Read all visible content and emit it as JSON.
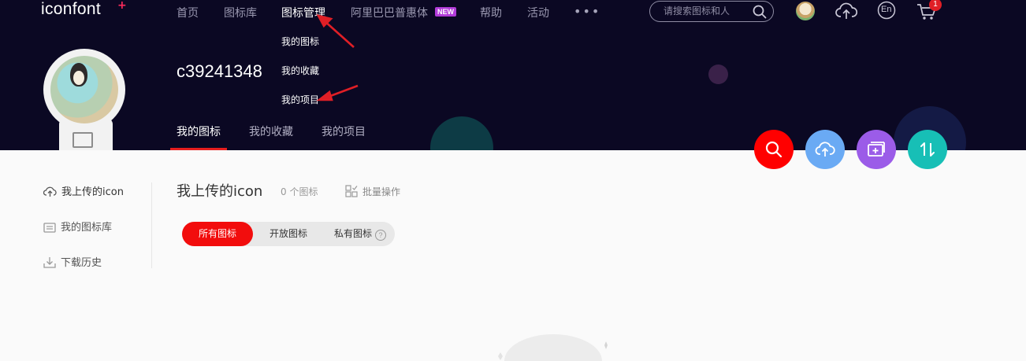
{
  "brand": {
    "logo_text": "iconfont",
    "logo_plus": "+"
  },
  "nav": {
    "items": [
      {
        "label": "首页"
      },
      {
        "label": "图标库"
      },
      {
        "label": "图标管理"
      },
      {
        "label": "阿里巴巴普惠体"
      },
      {
        "label": "帮助"
      },
      {
        "label": "活动"
      }
    ],
    "new_badge": "NEW",
    "more": "•••"
  },
  "search": {
    "placeholder": "请搜索图标和人"
  },
  "header_actions": {
    "lang_label": "En",
    "cart_count": "1"
  },
  "dropdown": {
    "items": [
      "我的图标",
      "我的收藏",
      "我的项目"
    ]
  },
  "profile": {
    "username": "c39241348"
  },
  "sub_tabs": [
    "我的图标",
    "我的收藏",
    "我的项目"
  ],
  "sidebar": {
    "items": [
      "我上传的icon",
      "我的图标库",
      "下载历史"
    ]
  },
  "main": {
    "title": "我上传的icon",
    "count": "0 个图标",
    "batch": "批量操作",
    "filters": [
      "所有图标",
      "开放图标",
      "私有图标"
    ],
    "help_mark": "?"
  },
  "colors": {
    "header_bg": "#0b0823",
    "accent_red": "#f20d0d",
    "search_btn": "#ff0000",
    "upload_btn": "#6aaaf4",
    "project_btn": "#9b5ce8",
    "sort_btn": "#17bfb6",
    "annotation_arrow": "#e01f26"
  }
}
